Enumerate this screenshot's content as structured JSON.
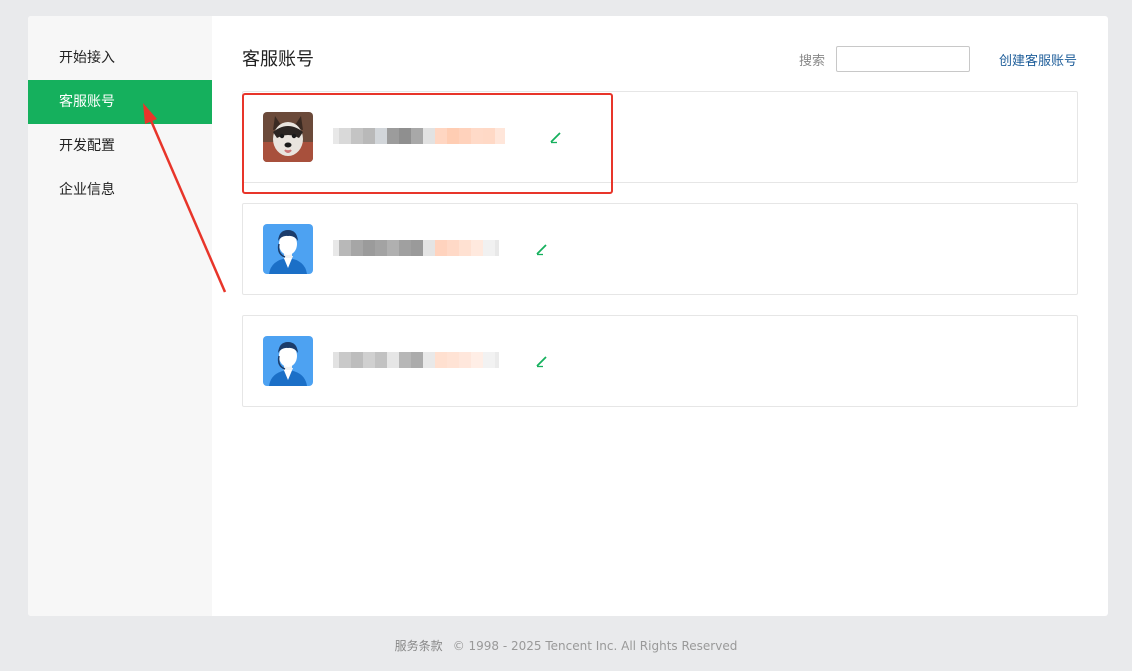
{
  "sidebar": {
    "items": [
      {
        "label": "开始接入",
        "active": false
      },
      {
        "label": "客服账号",
        "active": true
      },
      {
        "label": "开发配置",
        "active": false
      },
      {
        "label": "企业信息",
        "active": false
      }
    ]
  },
  "header": {
    "title": "客服账号",
    "search_label": "搜索",
    "search_value": "",
    "create_label": "创建客服账号"
  },
  "accounts": [
    {
      "avatar": "husky-dog-photo",
      "name": "",
      "edit_icon": "edit-pencil-icon"
    },
    {
      "avatar": "default-agent-avatar",
      "name": "",
      "edit_icon": "edit-pencil-icon"
    },
    {
      "avatar": "default-agent-avatar",
      "name": "",
      "edit_icon": "edit-pencil-icon"
    }
  ],
  "footer": {
    "terms_label": "服务条款",
    "copyright": "© 1998 - 2025 Tencent Inc. All Rights Reserved"
  },
  "colors": {
    "accent": "#15b05d",
    "annotation": "#e8352a",
    "link": "#1f5e9a"
  }
}
